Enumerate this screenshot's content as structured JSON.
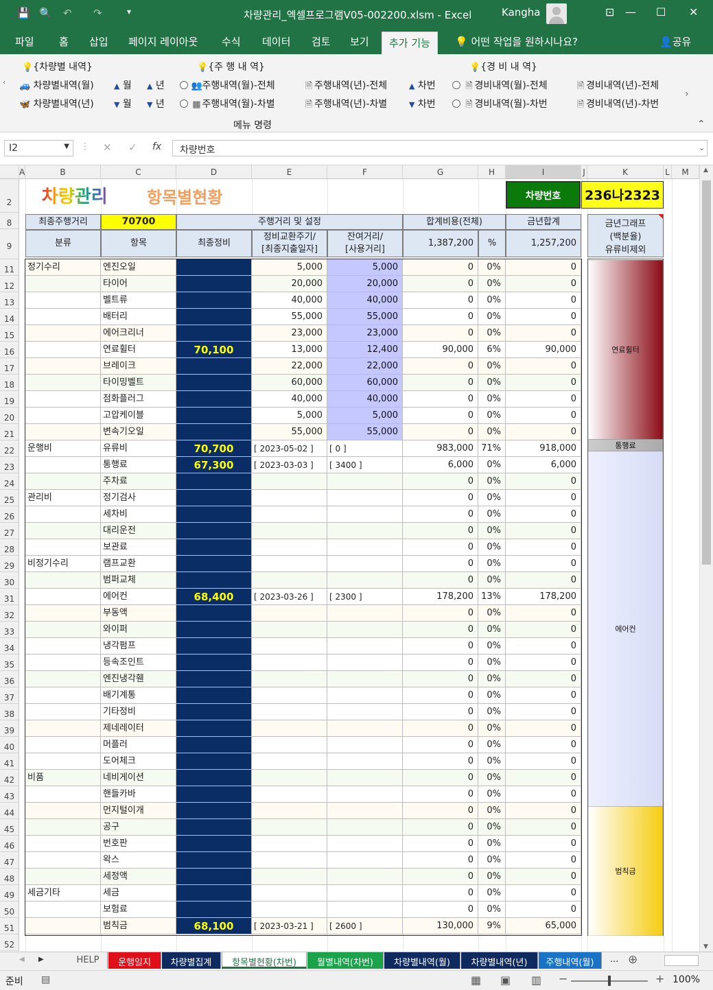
{
  "window": {
    "title": "차량관리_엑셀프로그램V05-002200.xlsm  -  Excel",
    "user": "Kangha"
  },
  "ribbon_tabs": [
    "파일",
    "홈",
    "삽입",
    "페이지 레이아웃",
    "수식",
    "데이터",
    "검토",
    "보기",
    "추가 기능"
  ],
  "tell_me": "어떤 작업을 원하시나요?",
  "share": "공유",
  "ribbon": {
    "group1_title": "{차량별 내역}",
    "group2_title": "{주 행 내 역}",
    "group3_title": "{경 비 내 역}",
    "cmd_vehicle_month": "차량별내역(월)",
    "cmd_vehicle_year": "차량별내역(년)",
    "month": "월",
    "year": "년",
    "carno": "차번",
    "cmd_drive_month_all": "주행내역(월)-전체",
    "cmd_drive_month_car": "주행내역(월)-차별",
    "cmd_drive_year_all": "주행내역(년)-전체",
    "cmd_drive_year_car": "주행내역(년)-차별",
    "cmd_exp_month_all": "경비내역(월)-전체",
    "cmd_exp_month_car": "경비내역(월)-차번",
    "cmd_exp_year_all": "경비내역(년)-전체",
    "cmd_exp_year_car": "경비내역(년)-차번",
    "menu_label": "메뉴 명령"
  },
  "formula": {
    "namebox": "I2",
    "fx": "fx",
    "content": "차량번호"
  },
  "columns": [
    "A",
    "B",
    "C",
    "D",
    "E",
    "F",
    "G",
    "H",
    "I",
    "J",
    "K",
    "L",
    "M"
  ],
  "rows": [
    "2",
    "8",
    "9",
    "11",
    "12",
    "13",
    "14",
    "15",
    "16",
    "17",
    "18",
    "19",
    "20",
    "21",
    "22",
    "23",
    "24",
    "25",
    "26",
    "27",
    "28",
    "29",
    "30",
    "31",
    "32",
    "33",
    "34",
    "35",
    "36",
    "37",
    "38",
    "39",
    "40",
    "41",
    "42",
    "43",
    "44",
    "45",
    "46",
    "47",
    "48",
    "49",
    "50",
    "51",
    "52"
  ],
  "header": {
    "logo_text": "차량관리",
    "subtitle": "항목별현황",
    "vehicle_label": "차량번호",
    "vehicle_no": "236나2323",
    "final_mileage_label": "최종주행거리",
    "final_mileage": "70700",
    "mileage_setting": "주행거리 및 설정",
    "total_cost": "합계비용(전체)",
    "year_total": "금년합계",
    "col_category": "분류",
    "col_item": "항목",
    "col_last": "최종정비",
    "col_cycle": "정비교환주기/\n[최종지출일자]",
    "col_remain": "잔여거리/\n[사용거리]",
    "total_cost_value": "1,387,200",
    "pct": "%",
    "year_total_value": "1,257,200",
    "graph_title": "금년그래프\n(백분율)\n유류비제외"
  },
  "table": [
    {
      "cat": "정기수리",
      "item": "엔진오일",
      "last": "",
      "cycle": "5,000",
      "remain": "5,000",
      "cost": "0",
      "pct": "0%",
      "year": "0"
    },
    {
      "cat": "",
      "item": "타이어",
      "last": "",
      "cycle": "20,000",
      "remain": "20,000",
      "cost": "0",
      "pct": "0%",
      "year": "0"
    },
    {
      "cat": "",
      "item": "벨트류",
      "last": "",
      "cycle": "40,000",
      "remain": "40,000",
      "cost": "0",
      "pct": "0%",
      "year": "0"
    },
    {
      "cat": "",
      "item": "배터리",
      "last": "",
      "cycle": "55,000",
      "remain": "55,000",
      "cost": "0",
      "pct": "0%",
      "year": "0"
    },
    {
      "cat": "",
      "item": "에어크리너",
      "last": "",
      "cycle": "23,000",
      "remain": "23,000",
      "cost": "0",
      "pct": "0%",
      "year": "0"
    },
    {
      "cat": "",
      "item": "연료휠터",
      "last": "70,100",
      "cycle": "13,000",
      "remain": "12,400",
      "cost": "90,000",
      "pct": "6%",
      "year": "90,000"
    },
    {
      "cat": "",
      "item": "브레이크",
      "last": "",
      "cycle": "22,000",
      "remain": "22,000",
      "cost": "0",
      "pct": "0%",
      "year": "0"
    },
    {
      "cat": "",
      "item": "타이밍벨트",
      "last": "",
      "cycle": "60,000",
      "remain": "60,000",
      "cost": "0",
      "pct": "0%",
      "year": "0"
    },
    {
      "cat": "",
      "item": "점화플러그",
      "last": "",
      "cycle": "40,000",
      "remain": "40,000",
      "cost": "0",
      "pct": "0%",
      "year": "0"
    },
    {
      "cat": "",
      "item": "고압케이블",
      "last": "",
      "cycle": "5,000",
      "remain": "5,000",
      "cost": "0",
      "pct": "0%",
      "year": "0"
    },
    {
      "cat": "",
      "item": "변속기오일",
      "last": "",
      "cycle": "55,000",
      "remain": "55,000",
      "cost": "0",
      "pct": "0%",
      "year": "0"
    },
    {
      "cat": "운행비",
      "item": "유류비",
      "last": "70,700",
      "cycle": "[ 2023-05-02 ]",
      "remain": "[ 0 ]",
      "cost": "983,000",
      "pct": "71%",
      "year": "918,000"
    },
    {
      "cat": "",
      "item": "통행료",
      "last": "67,300",
      "cycle": "[ 2023-03-03 ]",
      "remain": "[ 3400 ]",
      "cost": "6,000",
      "pct": "0%",
      "year": "6,000"
    },
    {
      "cat": "",
      "item": "주차료",
      "last": "",
      "cycle": "",
      "remain": "",
      "cost": "0",
      "pct": "0%",
      "year": "0"
    },
    {
      "cat": "관리비",
      "item": "정기검사",
      "last": "",
      "cycle": "",
      "remain": "",
      "cost": "0",
      "pct": "0%",
      "year": "0"
    },
    {
      "cat": "",
      "item": "세차비",
      "last": "",
      "cycle": "",
      "remain": "",
      "cost": "0",
      "pct": "0%",
      "year": "0"
    },
    {
      "cat": "",
      "item": "대리운전",
      "last": "",
      "cycle": "",
      "remain": "",
      "cost": "0",
      "pct": "0%",
      "year": "0"
    },
    {
      "cat": "",
      "item": "보관료",
      "last": "",
      "cycle": "",
      "remain": "",
      "cost": "0",
      "pct": "0%",
      "year": "0"
    },
    {
      "cat": "비정기수리",
      "item": "램프교환",
      "last": "",
      "cycle": "",
      "remain": "",
      "cost": "0",
      "pct": "0%",
      "year": "0"
    },
    {
      "cat": "",
      "item": "범퍼교체",
      "last": "",
      "cycle": "",
      "remain": "",
      "cost": "0",
      "pct": "0%",
      "year": "0"
    },
    {
      "cat": "",
      "item": "에어컨",
      "last": "68,400",
      "cycle": "[ 2023-03-26 ]",
      "remain": "[ 2300 ]",
      "cost": "178,200",
      "pct": "13%",
      "year": "178,200"
    },
    {
      "cat": "",
      "item": "부동액",
      "last": "",
      "cycle": "",
      "remain": "",
      "cost": "0",
      "pct": "0%",
      "year": "0"
    },
    {
      "cat": "",
      "item": "와이퍼",
      "last": "",
      "cycle": "",
      "remain": "",
      "cost": "0",
      "pct": "0%",
      "year": "0"
    },
    {
      "cat": "",
      "item": "냉각펌프",
      "last": "",
      "cycle": "",
      "remain": "",
      "cost": "0",
      "pct": "0%",
      "year": "0"
    },
    {
      "cat": "",
      "item": "등속조인트",
      "last": "",
      "cycle": "",
      "remain": "",
      "cost": "0",
      "pct": "0%",
      "year": "0"
    },
    {
      "cat": "",
      "item": "엔진냉각휀",
      "last": "",
      "cycle": "",
      "remain": "",
      "cost": "0",
      "pct": "0%",
      "year": "0"
    },
    {
      "cat": "",
      "item": "배기계통",
      "last": "",
      "cycle": "",
      "remain": "",
      "cost": "0",
      "pct": "0%",
      "year": "0"
    },
    {
      "cat": "",
      "item": "기타정비",
      "last": "",
      "cycle": "",
      "remain": "",
      "cost": "0",
      "pct": "0%",
      "year": "0"
    },
    {
      "cat": "",
      "item": "제네레이터",
      "last": "",
      "cycle": "",
      "remain": "",
      "cost": "0",
      "pct": "0%",
      "year": "0"
    },
    {
      "cat": "",
      "item": "머플러",
      "last": "",
      "cycle": "",
      "remain": "",
      "cost": "0",
      "pct": "0%",
      "year": "0"
    },
    {
      "cat": "",
      "item": "도어체크",
      "last": "",
      "cycle": "",
      "remain": "",
      "cost": "0",
      "pct": "0%",
      "year": "0"
    },
    {
      "cat": "비품",
      "item": "네비게이션",
      "last": "",
      "cycle": "",
      "remain": "",
      "cost": "0",
      "pct": "0%",
      "year": "0"
    },
    {
      "cat": "",
      "item": "핸들카바",
      "last": "",
      "cycle": "",
      "remain": "",
      "cost": "0",
      "pct": "0%",
      "year": "0"
    },
    {
      "cat": "",
      "item": "먼지털이개",
      "last": "",
      "cycle": "",
      "remain": "",
      "cost": "0",
      "pct": "0%",
      "year": "0"
    },
    {
      "cat": "",
      "item": "공구",
      "last": "",
      "cycle": "",
      "remain": "",
      "cost": "0",
      "pct": "0%",
      "year": "0"
    },
    {
      "cat": "",
      "item": "번호판",
      "last": "",
      "cycle": "",
      "remain": "",
      "cost": "0",
      "pct": "0%",
      "year": "0"
    },
    {
      "cat": "",
      "item": "왁스",
      "last": "",
      "cycle": "",
      "remain": "",
      "cost": "0",
      "pct": "0%",
      "year": "0"
    },
    {
      "cat": "",
      "item": "세정액",
      "last": "",
      "cycle": "",
      "remain": "",
      "cost": "0",
      "pct": "0%",
      "year": "0"
    },
    {
      "cat": "세금기타",
      "item": "세금",
      "last": "",
      "cycle": "",
      "remain": "",
      "cost": "0",
      "pct": "0%",
      "year": "0"
    },
    {
      "cat": "",
      "item": "보험료",
      "last": "",
      "cycle": "",
      "remain": "",
      "cost": "0",
      "pct": "0%",
      "year": "0"
    },
    {
      "cat": "",
      "item": "범칙금",
      "last": "68,100",
      "cycle": "[ 2023-03-21 ]",
      "remain": "[ 2600 ]",
      "cost": "130,000",
      "pct": "9%",
      "year": "65,000"
    }
  ],
  "chart_data": {
    "type": "bar",
    "categories": [
      "연료휠터",
      "통행료",
      "에어컨",
      "범칙금"
    ],
    "values": [
      90000,
      6000,
      178200,
      65000
    ],
    "colors": [
      "#8b0b16",
      "#aaaaaa",
      "#d6dcf5",
      "#f5cc10"
    ]
  },
  "sheet_tabs": [
    "HELP",
    "운행일지",
    "차량별집계",
    "항목별현황(차번)",
    "월별내역(차번)",
    "차량별내역(월)",
    "차량별내역(년)",
    "주행내역(월)"
  ],
  "sheet_tab_colors": [
    "#f0f0f0",
    "#e0101a",
    "#0f2a5e",
    "#ffffff",
    "#1aa34a",
    "#0f2a5e",
    "#0f2a5e",
    "#1a73c4"
  ],
  "status": {
    "ready": "준비",
    "zoom": "100%"
  }
}
